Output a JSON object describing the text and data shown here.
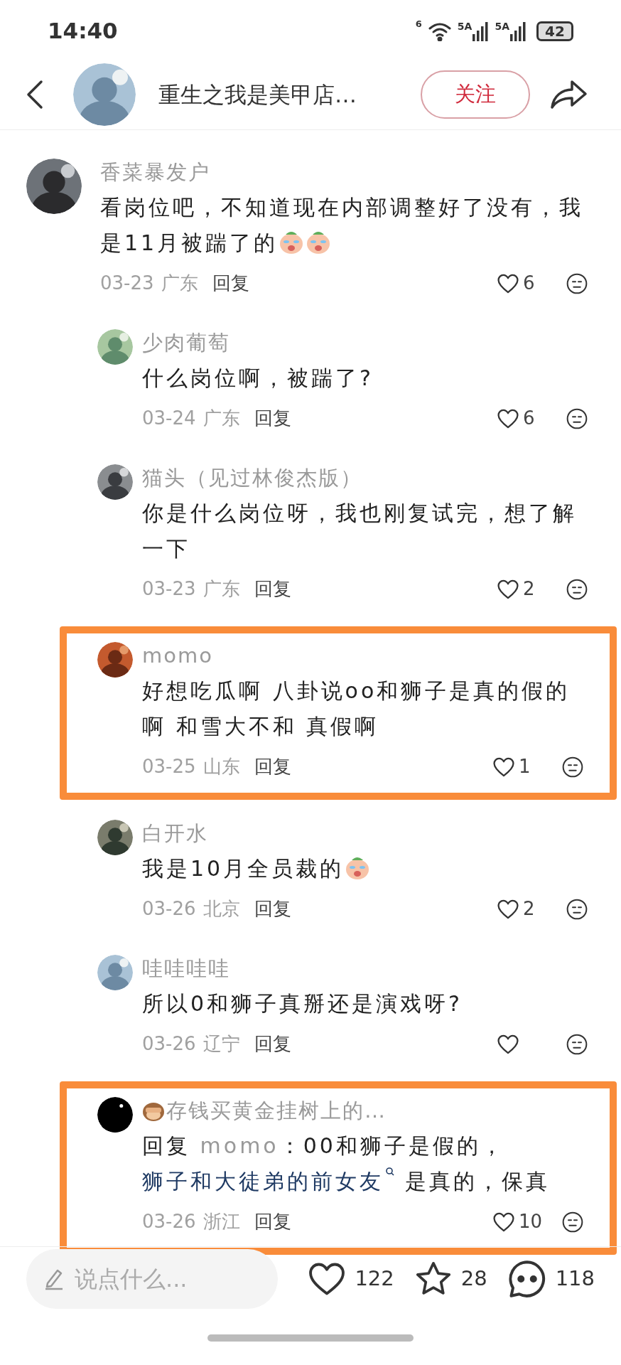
{
  "status_bar": {
    "time": "14:40",
    "wifi_label": "6",
    "sim_labels": [
      "5A",
      "5A"
    ],
    "battery": "42"
  },
  "header": {
    "title": "重生之我是美甲店…",
    "follow_button": "关注"
  },
  "comments": [
    {
      "kind": "top",
      "name": "香菜暴发户",
      "body": [
        {
          "kind": "text",
          "text": "看岗位吧，不知道现在内部调整好了没有，我是11月被踹了的"
        }
      ],
      "stickers": [
        {
          "kind": "crying"
        },
        {
          "kind": "crying"
        }
      ],
      "date": "03-23",
      "region": "广东",
      "reply": "回复",
      "likes": "6",
      "highlighted": false
    },
    {
      "kind": "reply",
      "name": "少肉葡萄",
      "body": [
        {
          "kind": "text",
          "text": "什么岗位啊，被踹了?"
        }
      ],
      "date": "03-24",
      "region": "广东",
      "reply": "回复",
      "likes": "6",
      "highlighted": false
    },
    {
      "kind": "reply",
      "name": "猫头（见过林俊杰版）",
      "body": [
        {
          "kind": "text",
          "text": "你是什么岗位呀，我也刚复试完，想了解一下"
        }
      ],
      "date": "03-23",
      "region": "广东",
      "reply": "回复",
      "likes": "2",
      "highlighted": false
    },
    {
      "kind": "reply",
      "name": "momo",
      "body": [
        {
          "kind": "text",
          "text": "好想吃瓜啊 八卦说oo和狮子是真的假的啊 和雪大不和 真假啊"
        }
      ],
      "date": "03-25",
      "region": "山东",
      "reply": "回复",
      "likes": "1",
      "highlighted": true
    },
    {
      "kind": "reply",
      "name": "白开水",
      "body": [
        {
          "kind": "text",
          "text": "我是10月全员裁的"
        }
      ],
      "stickers": [
        {
          "kind": "crying"
        }
      ],
      "date": "03-26",
      "region": "北京",
      "reply": "回复",
      "likes": "2",
      "highlighted": false
    },
    {
      "kind": "reply",
      "name": "哇哇哇哇",
      "body": [
        {
          "kind": "text",
          "text": "所以0和狮子真掰还是演戏呀?"
        }
      ],
      "date": "03-26",
      "region": "辽宁",
      "reply": "回复",
      "highlighted": false
    },
    {
      "kind": "reply",
      "name_badge": {
        "kind": "monkey"
      },
      "name": "存钱买黄金挂树上的…",
      "body": [
        {
          "kind": "text",
          "text": "回复 "
        },
        {
          "kind": "mention",
          "text": "momo"
        },
        {
          "kind": "text",
          "text": "：00和狮子是假的， "
        },
        {
          "kind": "link",
          "text": "狮子和大徒弟的前女友"
        },
        {
          "kind": "text",
          "text": " 是真的，保真"
        }
      ],
      "date": "03-26",
      "region": "浙江",
      "reply": "回复",
      "likes": "10",
      "highlighted": true
    }
  ],
  "bottom_bar": {
    "input": {
      "placeholder": "说点什么..."
    },
    "likes": "122",
    "stars": "28",
    "comments": "118"
  }
}
